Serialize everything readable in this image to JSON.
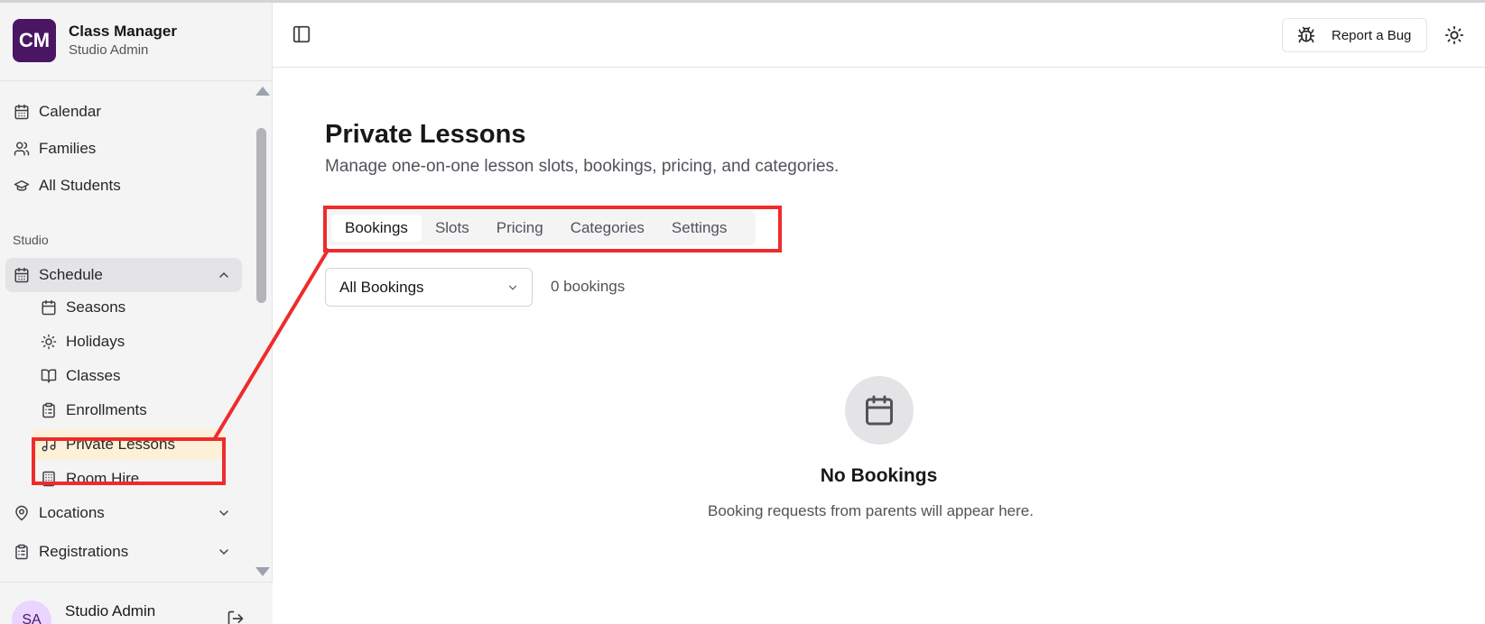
{
  "app": {
    "logo_text": "CM",
    "name": "Class Manager",
    "role": "Studio Admin"
  },
  "sidebar": {
    "top_items": [
      {
        "label": "Calendar",
        "icon": "calendar-icon"
      },
      {
        "label": "Families",
        "icon": "users-icon"
      },
      {
        "label": "All Students",
        "icon": "graduation-cap-icon"
      }
    ],
    "section_label": "Studio",
    "schedule": {
      "label": "Schedule",
      "expanded": true,
      "children": [
        {
          "label": "Seasons",
          "icon": "calendar-icon"
        },
        {
          "label": "Holidays",
          "icon": "sun-icon"
        },
        {
          "label": "Classes",
          "icon": "book-icon"
        },
        {
          "label": "Enrollments",
          "icon": "clipboard-icon"
        },
        {
          "label": "Private Lessons",
          "icon": "music-icon",
          "active": true
        },
        {
          "label": "Room Hire",
          "icon": "building-icon"
        }
      ]
    },
    "locations": {
      "label": "Locations"
    },
    "registrations": {
      "label": "Registrations"
    },
    "user": {
      "initials": "SA",
      "name": "Studio Admin"
    }
  },
  "header": {
    "bug_button": "Report a Bug"
  },
  "page": {
    "title": "Private Lessons",
    "subtitle": "Manage one-on-one lesson slots, bookings, pricing, and categories.",
    "tabs": [
      "Bookings",
      "Slots",
      "Pricing",
      "Categories",
      "Settings"
    ],
    "active_tab": "Bookings",
    "filter": {
      "selected": "All Bookings"
    },
    "count": "0 bookings",
    "empty": {
      "title": "No Bookings",
      "message": "Booking requests from parents will appear here."
    }
  },
  "colors": {
    "brand": "#4a1664",
    "highlight": "#ef2b2b",
    "active_bg": "#fdf0d8"
  }
}
